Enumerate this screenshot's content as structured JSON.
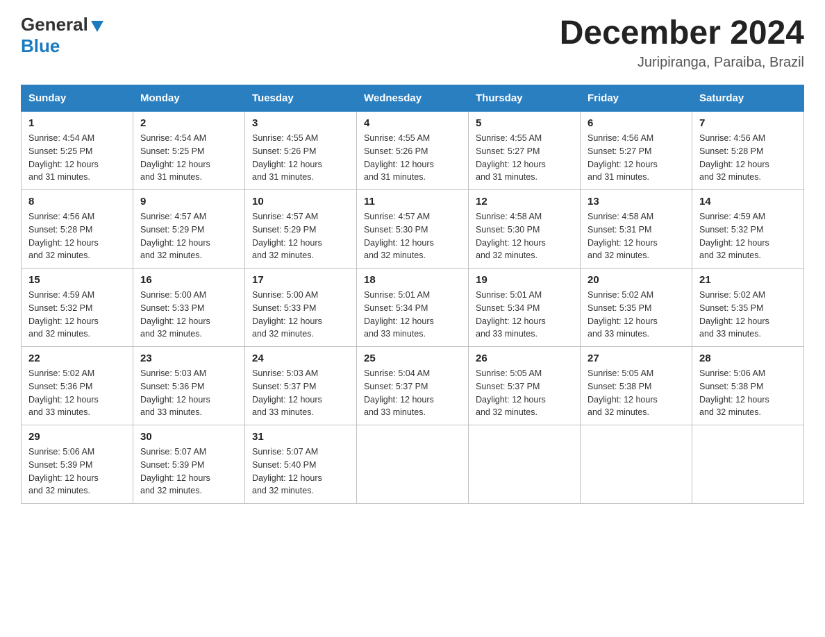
{
  "header": {
    "logo_general": "General",
    "logo_blue": "Blue",
    "month_title": "December 2024",
    "location": "Juripiranga, Paraiba, Brazil"
  },
  "calendar": {
    "days_of_week": [
      "Sunday",
      "Monday",
      "Tuesday",
      "Wednesday",
      "Thursday",
      "Friday",
      "Saturday"
    ],
    "weeks": [
      [
        {
          "day": "1",
          "sunrise": "4:54 AM",
          "sunset": "5:25 PM",
          "daylight": "12 hours and 31 minutes."
        },
        {
          "day": "2",
          "sunrise": "4:54 AM",
          "sunset": "5:25 PM",
          "daylight": "12 hours and 31 minutes."
        },
        {
          "day": "3",
          "sunrise": "4:55 AM",
          "sunset": "5:26 PM",
          "daylight": "12 hours and 31 minutes."
        },
        {
          "day": "4",
          "sunrise": "4:55 AM",
          "sunset": "5:26 PM",
          "daylight": "12 hours and 31 minutes."
        },
        {
          "day": "5",
          "sunrise": "4:55 AM",
          "sunset": "5:27 PM",
          "daylight": "12 hours and 31 minutes."
        },
        {
          "day": "6",
          "sunrise": "4:56 AM",
          "sunset": "5:27 PM",
          "daylight": "12 hours and 31 minutes."
        },
        {
          "day": "7",
          "sunrise": "4:56 AM",
          "sunset": "5:28 PM",
          "daylight": "12 hours and 32 minutes."
        }
      ],
      [
        {
          "day": "8",
          "sunrise": "4:56 AM",
          "sunset": "5:28 PM",
          "daylight": "12 hours and 32 minutes."
        },
        {
          "day": "9",
          "sunrise": "4:57 AM",
          "sunset": "5:29 PM",
          "daylight": "12 hours and 32 minutes."
        },
        {
          "day": "10",
          "sunrise": "4:57 AM",
          "sunset": "5:29 PM",
          "daylight": "12 hours and 32 minutes."
        },
        {
          "day": "11",
          "sunrise": "4:57 AM",
          "sunset": "5:30 PM",
          "daylight": "12 hours and 32 minutes."
        },
        {
          "day": "12",
          "sunrise": "4:58 AM",
          "sunset": "5:30 PM",
          "daylight": "12 hours and 32 minutes."
        },
        {
          "day": "13",
          "sunrise": "4:58 AM",
          "sunset": "5:31 PM",
          "daylight": "12 hours and 32 minutes."
        },
        {
          "day": "14",
          "sunrise": "4:59 AM",
          "sunset": "5:32 PM",
          "daylight": "12 hours and 32 minutes."
        }
      ],
      [
        {
          "day": "15",
          "sunrise": "4:59 AM",
          "sunset": "5:32 PM",
          "daylight": "12 hours and 32 minutes."
        },
        {
          "day": "16",
          "sunrise": "5:00 AM",
          "sunset": "5:33 PM",
          "daylight": "12 hours and 32 minutes."
        },
        {
          "day": "17",
          "sunrise": "5:00 AM",
          "sunset": "5:33 PM",
          "daylight": "12 hours and 32 minutes."
        },
        {
          "day": "18",
          "sunrise": "5:01 AM",
          "sunset": "5:34 PM",
          "daylight": "12 hours and 33 minutes."
        },
        {
          "day": "19",
          "sunrise": "5:01 AM",
          "sunset": "5:34 PM",
          "daylight": "12 hours and 33 minutes."
        },
        {
          "day": "20",
          "sunrise": "5:02 AM",
          "sunset": "5:35 PM",
          "daylight": "12 hours and 33 minutes."
        },
        {
          "day": "21",
          "sunrise": "5:02 AM",
          "sunset": "5:35 PM",
          "daylight": "12 hours and 33 minutes."
        }
      ],
      [
        {
          "day": "22",
          "sunrise": "5:02 AM",
          "sunset": "5:36 PM",
          "daylight": "12 hours and 33 minutes."
        },
        {
          "day": "23",
          "sunrise": "5:03 AM",
          "sunset": "5:36 PM",
          "daylight": "12 hours and 33 minutes."
        },
        {
          "day": "24",
          "sunrise": "5:03 AM",
          "sunset": "5:37 PM",
          "daylight": "12 hours and 33 minutes."
        },
        {
          "day": "25",
          "sunrise": "5:04 AM",
          "sunset": "5:37 PM",
          "daylight": "12 hours and 33 minutes."
        },
        {
          "day": "26",
          "sunrise": "5:05 AM",
          "sunset": "5:37 PM",
          "daylight": "12 hours and 32 minutes."
        },
        {
          "day": "27",
          "sunrise": "5:05 AM",
          "sunset": "5:38 PM",
          "daylight": "12 hours and 32 minutes."
        },
        {
          "day": "28",
          "sunrise": "5:06 AM",
          "sunset": "5:38 PM",
          "daylight": "12 hours and 32 minutes."
        }
      ],
      [
        {
          "day": "29",
          "sunrise": "5:06 AM",
          "sunset": "5:39 PM",
          "daylight": "12 hours and 32 minutes."
        },
        {
          "day": "30",
          "sunrise": "5:07 AM",
          "sunset": "5:39 PM",
          "daylight": "12 hours and 32 minutes."
        },
        {
          "day": "31",
          "sunrise": "5:07 AM",
          "sunset": "5:40 PM",
          "daylight": "12 hours and 32 minutes."
        },
        null,
        null,
        null,
        null
      ]
    ]
  },
  "labels": {
    "sunrise": "Sunrise:",
    "sunset": "Sunset:",
    "daylight": "Daylight:"
  }
}
